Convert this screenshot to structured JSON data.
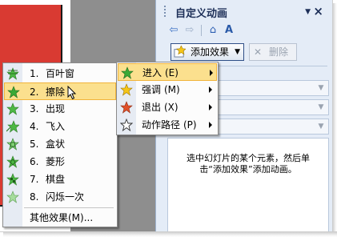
{
  "task_pane": {
    "title": "自定义动画",
    "add_effect_label": "添加效果",
    "remove_label": "删除",
    "hint_text": "选中幻灯片的某个元素，然后单击“添加效果”添加动画。"
  },
  "submenu": {
    "items": [
      {
        "num": "1.",
        "label": "百叶窗",
        "icon": "blinds-effect-icon"
      },
      {
        "num": "2.",
        "label": "擦除",
        "icon": "wipe-effect-icon"
      },
      {
        "num": "3.",
        "label": "出现",
        "icon": "appear-effect-icon"
      },
      {
        "num": "4.",
        "label": "飞入",
        "icon": "fly-in-effect-icon"
      },
      {
        "num": "5.",
        "label": "盒状",
        "icon": "box-effect-icon"
      },
      {
        "num": "6.",
        "label": "菱形",
        "icon": "diamond-effect-icon"
      },
      {
        "num": "7.",
        "label": "棋盘",
        "icon": "checkerboard-effect-icon"
      },
      {
        "num": "8.",
        "label": "闪烁一次",
        "icon": "flash-once-effect-icon"
      }
    ],
    "more_label": "其他效果(M)..."
  },
  "effect_menu": {
    "items": [
      {
        "label": "进入",
        "key": "(E)",
        "icon": "entrance-star-icon"
      },
      {
        "label": "强调",
        "key": "(M)",
        "icon": "emphasis-star-icon"
      },
      {
        "label": "退出",
        "key": "(X)",
        "icon": "exit-star-icon"
      },
      {
        "label": "动作路径",
        "key": "(P)",
        "icon": "motion-path-star-icon"
      }
    ]
  },
  "colors": {
    "pane_bg": "#e4ecf7",
    "highlight": "#fbe08e",
    "slide_shape": "#d93a32"
  }
}
